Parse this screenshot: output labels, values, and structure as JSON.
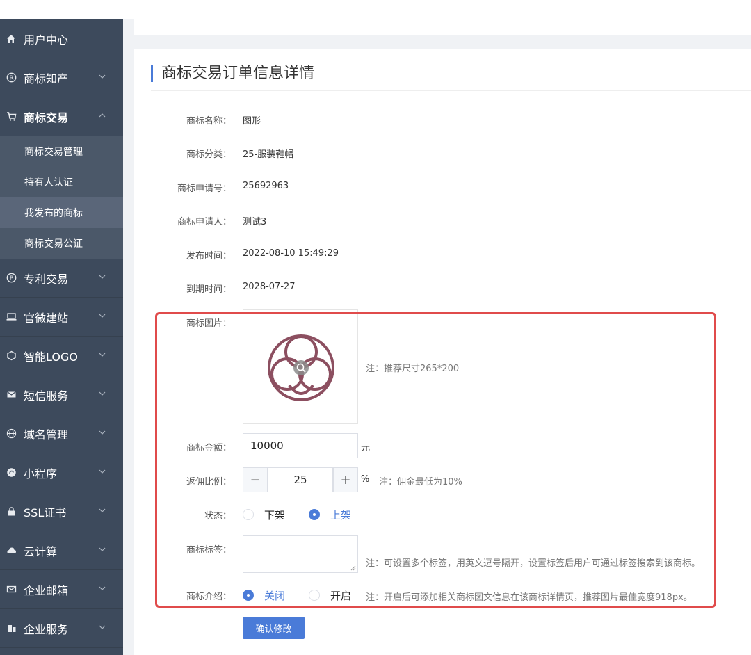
{
  "sidebar": {
    "items": [
      {
        "label": "用户中心"
      },
      {
        "label": "商标知产"
      },
      {
        "label": "商标交易"
      },
      {
        "label": "专利交易"
      },
      {
        "label": "官微建站"
      },
      {
        "label": "智能LOGO"
      },
      {
        "label": "短信服务"
      },
      {
        "label": "域名管理"
      },
      {
        "label": "小程序"
      },
      {
        "label": "SSL证书"
      },
      {
        "label": "云计算"
      },
      {
        "label": "企业邮箱"
      },
      {
        "label": "企业服务"
      }
    ],
    "sub_items": [
      {
        "label": "商标交易管理"
      },
      {
        "label": "持有人认证"
      },
      {
        "label": "我发布的商标"
      },
      {
        "label": "商标交易公证"
      }
    ]
  },
  "page": {
    "title": "商标交易订单信息详情"
  },
  "details": {
    "name_label": "商标名称：",
    "name_value": "图形",
    "class_label": "商标分类：",
    "class_value": "25-服装鞋帽",
    "regno_label": "商标申请号：",
    "regno_value": "25692963",
    "applicant_label": "商标申请人：",
    "applicant_value": "测试3",
    "publish_label": "发布时间：",
    "publish_value": "2022-08-10 15:49:29",
    "expire_label": "到期时间：",
    "expire_value": "2028-07-27"
  },
  "form": {
    "image_label": "商标图片：",
    "image_note": "注：推荐尺寸265*200",
    "amount_label": "商标金额：",
    "amount_value": "10000",
    "amount_unit": "元",
    "ratio_label": "返佣比例：",
    "ratio_value": "25",
    "ratio_unit": "%",
    "ratio_note": "注：佣金最低为10%",
    "ratio_minus": "−",
    "ratio_plus": "+",
    "status_label": "状态：",
    "status_off": "下架",
    "status_on": "上架",
    "tags_label": "商标标签：",
    "tags_value": "",
    "tags_note": "注：可设置多个标签，用英文逗号隔开，设置标签后用户可通过标签搜索到该商标。",
    "intro_label": "商标介绍：",
    "intro_off": "关闭",
    "intro_on": "开启",
    "intro_note": "注：开启后可添加相关商标图文信息在该商标详情页，推荐图片最佳宽度918px。",
    "submit": "确认修改"
  },
  "colors": {
    "sidebar_bg": "#3d4a5c",
    "accent": "#4a7bd8",
    "highlight": "#e04b4b",
    "logo_mark": "#8c4f60"
  }
}
